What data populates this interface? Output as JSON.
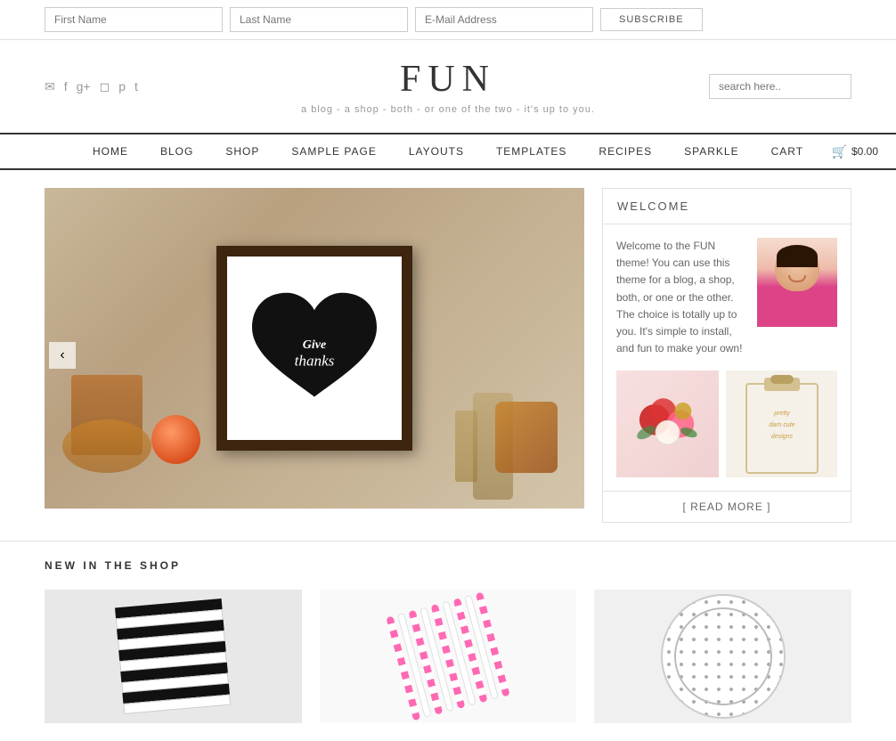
{
  "subscribe_bar": {
    "first_name_placeholder": "First Name",
    "last_name_placeholder": "Last Name",
    "email_placeholder": "E-Mail Address",
    "subscribe_label": "SUBSCRIBE"
  },
  "header": {
    "site_title": "FUN",
    "site_tagline": "a blog - a shop - both - or one of the two - it's up to you.",
    "search_placeholder": "search here..",
    "social_icons": [
      "email",
      "facebook",
      "google-plus",
      "instagram",
      "pinterest",
      "twitter"
    ]
  },
  "nav": {
    "links": [
      {
        "label": "HOME",
        "id": "home"
      },
      {
        "label": "BLOG",
        "id": "blog"
      },
      {
        "label": "SHOP",
        "id": "shop"
      },
      {
        "label": "SAMPLE PAGE",
        "id": "sample-page"
      },
      {
        "label": "LAYOUTS",
        "id": "layouts"
      },
      {
        "label": "TEMPLATES",
        "id": "templates"
      },
      {
        "label": "RECIPES",
        "id": "recipes"
      },
      {
        "label": "SPARKLE",
        "id": "sparkle"
      },
      {
        "label": "CART",
        "id": "cart"
      }
    ],
    "cart_amount": "$0.00"
  },
  "welcome": {
    "title": "WELCOME",
    "text": "Welcome to the FUN theme! You can use this theme for a blog, a shop, both, or one or the other. The choice is totally up to you. It's simple to install, and fun to make your own!",
    "read_more": "[ READ MORE ]"
  },
  "shop_section": {
    "title": "NEW IN THE SHOP"
  }
}
